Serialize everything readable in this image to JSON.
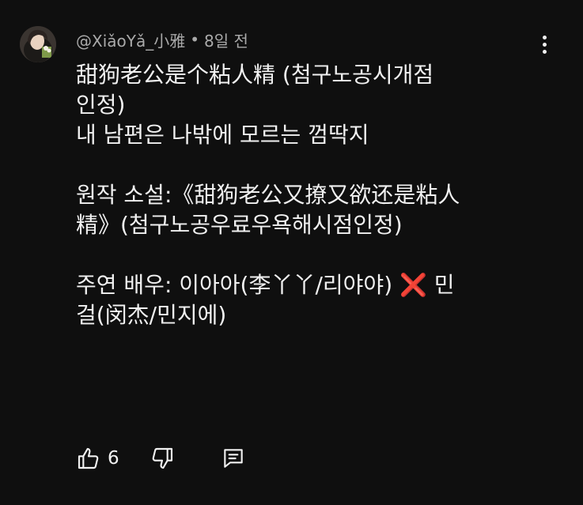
{
  "comment": {
    "author": "@XiǎoYǎ_小雅",
    "separator": "•",
    "timestamp": "8일 전",
    "lines": [
      "甜狗老公是个粘人精 (첨구노공시개점",
      "인정)",
      "내 남편은 나밖에 모르는 껌딱지",
      "",
      "원작 소설:《甜狗老公又撩又欲还是粘人",
      "精》(첨구노공우료우욕해시점인정)",
      "",
      "주연 배우: 이아아(李丫丫/리야야) ❌ 민",
      "걸(闵杰/민지에)"
    ],
    "like_count": "6"
  },
  "icons": {
    "menu": "more-vertical-icon",
    "like": "thumbs-up-icon",
    "dislike": "thumbs-down-icon",
    "reply": "reply-comment-icon"
  },
  "colors": {
    "background": "#0f0f0f",
    "text": "#f1f1f1",
    "meta": "#aaaaaa",
    "cross": "#e02424"
  }
}
